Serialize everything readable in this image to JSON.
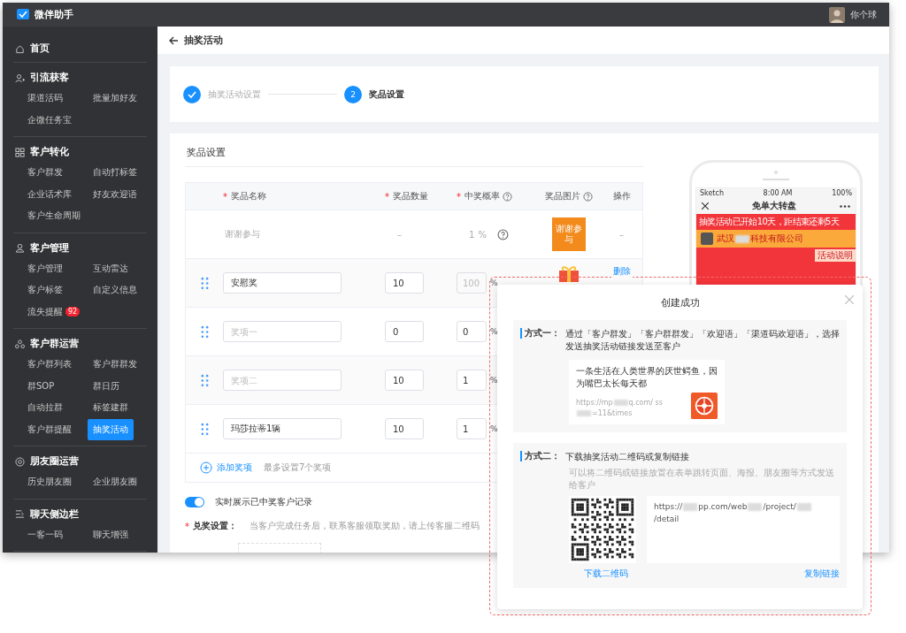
{
  "app": {
    "name": "微伴助手",
    "user": "你个球"
  },
  "sidebar": [
    {
      "title": "首页"
    },
    {
      "title": "引流获客",
      "items": [
        {
          "label": "渠道活码",
          "selected": false
        },
        {
          "label": "批量加好友",
          "selected": false
        },
        {
          "label": "企微任务宝",
          "selected": false
        }
      ]
    },
    {
      "title": "客户转化",
      "items": [
        {
          "label": "客户群发",
          "selected": false
        },
        {
          "label": "自动打标签",
          "selected": false
        },
        {
          "label": "企业话术库",
          "selected": false
        },
        {
          "label": "好友欢迎语",
          "selected": false
        },
        {
          "label": "客户生命周期",
          "selected": false
        }
      ]
    },
    {
      "title": "客户管理",
      "items": [
        {
          "label": "客户管理",
          "selected": false
        },
        {
          "label": "互动雷达",
          "selected": false
        },
        {
          "label": "客户标签",
          "selected": false
        },
        {
          "label": "自定义信息",
          "selected": false
        },
        {
          "label": "流失提醒",
          "selected": false,
          "badge": "92"
        }
      ]
    },
    {
      "title": "客户群运营",
      "items": [
        {
          "label": "客户群列表",
          "selected": false
        },
        {
          "label": "客户群群发",
          "selected": false
        },
        {
          "label": "群SOP",
          "selected": false
        },
        {
          "label": "群日历",
          "selected": false
        },
        {
          "label": "自动拉群",
          "selected": false
        },
        {
          "label": "标签建群",
          "selected": false
        },
        {
          "label": "客户群提醒",
          "selected": false
        },
        {
          "label": "抽奖活动",
          "selected": true
        }
      ]
    },
    {
      "title": "朋友圈运营",
      "items": [
        {
          "label": "历史朋友圈",
          "selected": false
        },
        {
          "label": "企业朋友圈",
          "selected": false
        }
      ]
    },
    {
      "title": "聊天侧边栏",
      "items": [
        {
          "label": "一客一码",
          "selected": false
        },
        {
          "label": "聊天增强",
          "selected": false
        }
      ]
    }
  ],
  "page_title": "抽奖活动",
  "steps": [
    {
      "label": "抽奖活动设置",
      "done": true
    },
    {
      "number": "2",
      "label": "奖品设置",
      "done": false
    }
  ],
  "prizes": {
    "title": "奖品设置",
    "columns": [
      {
        "label": "奖品名称",
        "star": "*",
        "help": false
      },
      {
        "label": "奖品数量",
        "star": "*",
        "help": false
      },
      {
        "label": "中奖概率",
        "star": "*",
        "help": true
      },
      {
        "label": "奖品图片",
        "help": true
      },
      {
        "label": "操作",
        "help": false
      }
    ],
    "rows": [
      {
        "kind": "fixed",
        "name": "谢谢参与",
        "quantity": "–",
        "probability": "1",
        "unit": "%",
        "image_text": "谢谢参与",
        "action": "–"
      },
      {
        "kind": "editable",
        "name": "安慰奖",
        "quantity": "10",
        "probability": "100",
        "probability_disabled": true,
        "unit": "%",
        "action": "删除"
      },
      {
        "kind": "editable",
        "placeholder": "奖项一",
        "quantity": "0",
        "probability": "0",
        "probability_disabled": false,
        "unit": "%"
      },
      {
        "kind": "editable",
        "placeholder": "奖项二",
        "quantity": "10",
        "probability": "1",
        "probability_disabled": false,
        "unit": "%"
      },
      {
        "kind": "editable",
        "name": "玛莎拉蒂1辆",
        "quantity": "10",
        "probability": "1",
        "probability_disabled": false,
        "unit": "%"
      }
    ],
    "add": {
      "label": "添加奖项",
      "hint": "最多设置7个奖项"
    },
    "toggle": {
      "label": "实时展示已中奖客户记录",
      "on": true
    },
    "redeem": {
      "star": "*",
      "label": "兑奖设置：",
      "hint": "当客户完成任务后，联系客服领取奖励，请上传客服二维码"
    }
  },
  "phone": {
    "carrier": "Sketch",
    "time": "8:00 AM",
    "battery": "100%",
    "title": "免单大转盘",
    "notice": "抽奖活动已开始10天，距结束还剩5天",
    "company": [
      "武汉",
      "科技有限公司"
    ],
    "tag": "活动说明"
  },
  "modal": {
    "title": "创建成功",
    "methods": [
      {
        "kind": "card",
        "label": "方式一：",
        "text": "通过「客户群发」「客户群群发」「欢迎语」「渠道码欢迎语」，选择发送抽奖活动链接发送至客户",
        "card_text": "一条生活在人类世界的厌世鳄鱼，因为嘴巴太长每天都",
        "url": [
          "https://mp",
          "q.com/ ss",
          "=11&times"
        ]
      },
      {
        "kind": "qr",
        "label": "方式二：",
        "text": "下载抽奖活动二维码或复制链接",
        "hint": "可以将二维码或链接放置在表单跳转页面、海报、朋友圈等方式发送给客户",
        "url": [
          "https://",
          "pp.com/web",
          "/project/",
          "/detail"
        ],
        "actions": [
          "下载二维码",
          "复制链接"
        ]
      }
    ]
  }
}
